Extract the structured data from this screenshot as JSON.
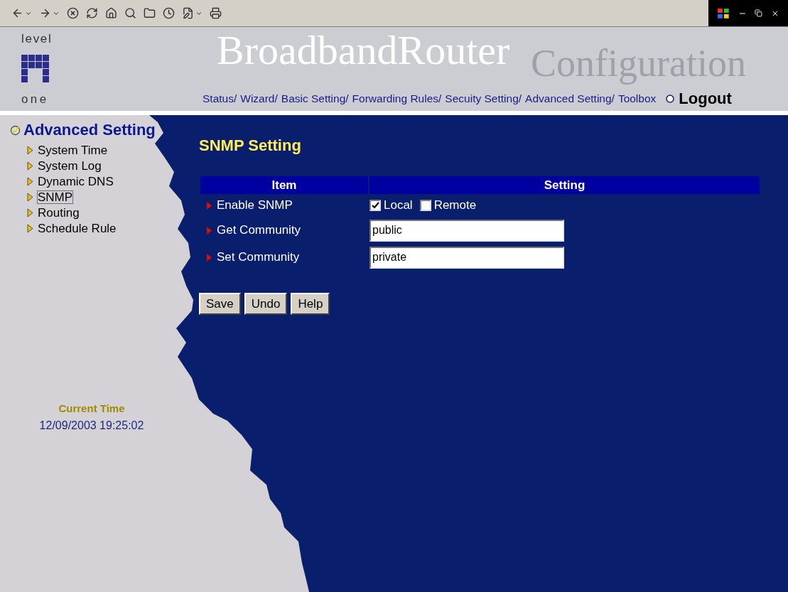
{
  "header": {
    "brand_top": "level",
    "brand_bottom": "one",
    "title": "BroadbandRouter",
    "subtitle": "Configuration",
    "nav": [
      {
        "label": "Status/"
      },
      {
        "label": "Wizard/"
      },
      {
        "label": "Basic Setting/"
      },
      {
        "label": "Forwarding Rules/"
      },
      {
        "label": "Secuity Setting/"
      },
      {
        "label": "Advanced Setting/"
      },
      {
        "label": "Toolbox"
      }
    ],
    "logout": "Logout"
  },
  "sidebar": {
    "title": "Advanced Setting",
    "items": [
      {
        "label": "System Time",
        "selected": false
      },
      {
        "label": "System Log",
        "selected": false
      },
      {
        "label": "Dynamic DNS",
        "selected": false
      },
      {
        "label": "SNMP",
        "selected": true
      },
      {
        "label": "Routing",
        "selected": false
      },
      {
        "label": "Schedule Rule",
        "selected": false
      }
    ],
    "current_time_label": "Current Time",
    "current_time": "12/09/2003 19:25:02"
  },
  "page": {
    "title": "SNMP Setting",
    "columns": [
      "Item",
      "Setting"
    ],
    "rows": [
      {
        "kind": "checkboxes",
        "label": "Enable SNMP",
        "options": [
          {
            "label": "Local",
            "checked": true
          },
          {
            "label": "Remote",
            "checked": false
          }
        ]
      },
      {
        "kind": "text",
        "label": "Get Community",
        "value": "public"
      },
      {
        "kind": "text",
        "label": "Set Community",
        "value": "private"
      }
    ],
    "buttons": [
      "Save",
      "Undo",
      "Help"
    ]
  }
}
